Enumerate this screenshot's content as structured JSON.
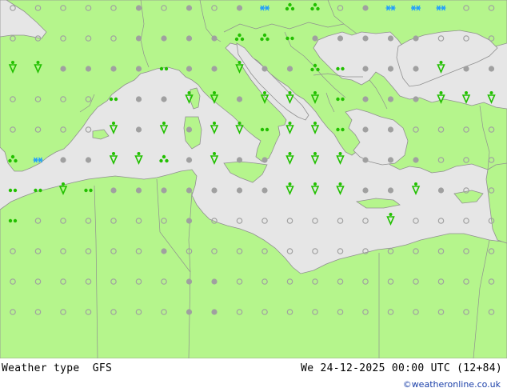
{
  "footer": {
    "title": "Weather type  GFS",
    "datetime": "We 24-12-2025 00:00 UTC (12+84)",
    "credit": "©weatheronline.co.uk"
  },
  "colors": {
    "land": "#b5f58c",
    "sea": "#e6e6e6",
    "rain": "#22c000",
    "snow": "#1f9cff",
    "dry": "#a0a0a0",
    "credit": "#1a3fa8"
  },
  "legend_symbols": {
    "dry": "dot",
    "cloudy": "open-circle",
    "rain": "rain-drop-icon",
    "drizzle": "drizzle-dots-icon",
    "showers": "shower-cluster-icon",
    "snow": "snowflake-icon"
  },
  "grid": {
    "columns": 20,
    "rows": 11,
    "cells": [
      [
        "o",
        "o",
        "o",
        "o",
        "o",
        ".",
        "o",
        ".",
        "o",
        ".",
        "snow",
        "sh",
        "sh",
        "o",
        ".",
        "snow",
        "snow",
        "snow",
        "o",
        "o"
      ],
      [
        "o",
        "o",
        "o",
        "o",
        "o",
        ".",
        ".",
        ".",
        ".",
        "sh",
        "sh",
        "dz",
        ".",
        ".",
        ".",
        ".",
        ".",
        "o",
        "o",
        "o"
      ],
      [
        "r",
        "r",
        ".",
        ".",
        ".",
        ".",
        "dz",
        ".",
        ".",
        "r",
        ".",
        ".",
        "sh",
        "dz",
        ".",
        ".",
        ".",
        "r",
        ".",
        "."
      ],
      [
        "o",
        "o",
        "o",
        "o",
        "dz",
        ".",
        ".",
        "r",
        "r",
        ".",
        "r",
        "r",
        "r",
        "dz",
        ".",
        ".",
        ".",
        "r",
        "r",
        "r"
      ],
      [
        "o",
        "o",
        "o",
        "o",
        "r",
        ".",
        "r",
        ".",
        "r",
        "r",
        "dz",
        "r",
        "r",
        "dz",
        ".",
        ".",
        "o",
        "o",
        "o",
        "o"
      ],
      [
        "sh",
        "snow",
        ".",
        ".",
        "r",
        "r",
        "sh",
        ".",
        "r",
        ".",
        ".",
        "r",
        "r",
        "r",
        ".",
        ".",
        ".",
        "o",
        "o",
        "o"
      ],
      [
        "dz",
        "dz",
        "r",
        "dz",
        ".",
        ".",
        ".",
        ".",
        ".",
        ".",
        ".",
        "r",
        "r",
        "r",
        ".",
        ".",
        "r",
        ".",
        "o",
        "o"
      ],
      [
        "dz",
        "o",
        "o",
        "o",
        "o",
        "o",
        "o",
        ".",
        "o",
        "o",
        "o",
        "o",
        "o",
        "o",
        "o",
        "r",
        "o",
        "o",
        "o",
        "o"
      ],
      [
        "o",
        "o",
        "o",
        "o",
        "o",
        "o",
        ".",
        "o",
        "o",
        "o",
        "o",
        "o",
        "o",
        "o",
        "o",
        "o",
        "o",
        "o",
        "o",
        "o"
      ],
      [
        "o",
        "o",
        "o",
        "o",
        "o",
        "o",
        "o",
        ".",
        ".",
        "o",
        "o",
        "o",
        "o",
        "o",
        "o",
        "o",
        "o",
        "o",
        "o",
        "o"
      ],
      [
        "o",
        "o",
        "o",
        "o",
        "o",
        "o",
        "o",
        ".",
        ".",
        "o",
        "o",
        "o",
        "o",
        "o",
        "o",
        "o",
        "o",
        "o",
        "o",
        "o"
      ]
    ]
  }
}
